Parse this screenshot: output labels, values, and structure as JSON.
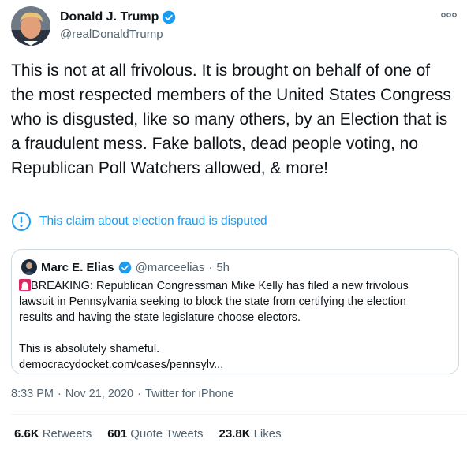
{
  "tweet": {
    "author_name": "Donald J. Trump",
    "author_handle": "@realDonaldTrump",
    "avatar_icon": "user-photo",
    "verified_icon": "verified-badge-icon",
    "more_icon": "more-options-icon",
    "text": "This is not at all frivolous. It is brought on behalf of one of the most respected members of the United States Congress who is disgusted, like so many others, by an Election that is a fraudulent mess. Fake ballots, dead people voting, no Republican Poll Watchers allowed, & more!",
    "notice": {
      "icon": "info-circle-icon",
      "text": "This claim about election fraud is disputed"
    },
    "quote": {
      "author_name": "Marc E. Elias",
      "author_handle": "@marceelias",
      "separator": "·",
      "time": "5h",
      "line1": "BREAKING: Republican Congressman Mike Kelly has filed a new frivolous",
      "line2": "lawsuit in Pennsylvania seeking to block the state from certifying the election",
      "line3": "results and having the state legislature choose electors.",
      "line4": "This is absolutely shameful.",
      "link": "democracydocket.com/cases/pennsylv..."
    },
    "timestamp_time": "8:33 PM",
    "timestamp_sep": "·",
    "timestamp_date": "Nov 21, 2020",
    "source_sep": "·",
    "source": "Twitter for iPhone",
    "stats": {
      "retweets_count": "6.6K",
      "retweets_label": "Retweets",
      "quotes_count": "601",
      "quotes_label": "Quote Tweets",
      "likes_count": "23.8K",
      "likes_label": "Likes"
    }
  },
  "colors": {
    "accent": "#1d9bf0",
    "text": "#0f1419",
    "secondary": "#536471",
    "border": "#cfd9de",
    "siren": "#e0245e"
  }
}
